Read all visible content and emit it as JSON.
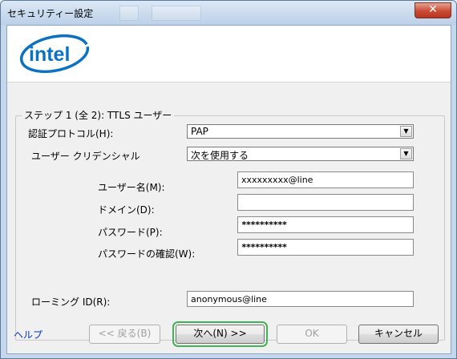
{
  "window": {
    "title": "セキュリティー設定",
    "close_label": "✕"
  },
  "logo": {
    "text": "intel"
  },
  "step": {
    "legend": "ステップ 1 (全 2): TTLS ユーザー",
    "auth_protocol_label": "認証プロトコル(H):",
    "auth_protocol_value": "PAP",
    "credentials_label": "ユーザー クリデンシャル",
    "credentials_value": "次を使用する",
    "username_label": "ユーザー名(M):",
    "username_value": "xxxxxxxxx@line",
    "domain_label": "ドメイン(D):",
    "domain_value": "",
    "password_label": "パスワード(P):",
    "password_value": "**********",
    "confirm_label": "パスワードの確認(W):",
    "confirm_value": "**********",
    "roaming_label": "ローミング ID(R):",
    "roaming_value": "anonymous@line"
  },
  "buttons": {
    "help": "ヘルプ",
    "back": "<< 戻る(B)",
    "next": "次へ(N) >>",
    "ok": "OK",
    "cancel": "キャンセル"
  },
  "colors": {
    "link": "#0033cc",
    "focus_outline": "#3fb34f",
    "logo_blue": "#0a71c5"
  }
}
